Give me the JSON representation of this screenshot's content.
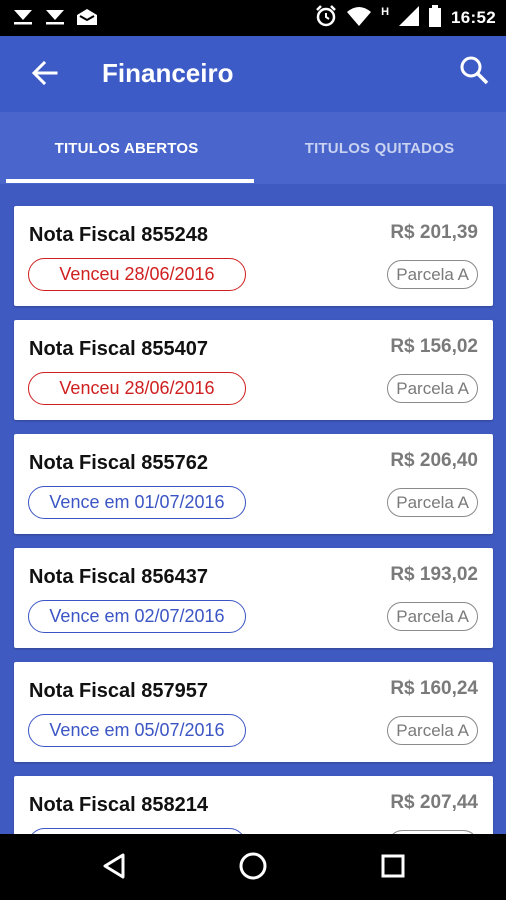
{
  "status_bar": {
    "time": "16:52",
    "icons": [
      "download-icon",
      "download-icon",
      "mail-icon",
      "alarm-icon",
      "wifi-icon",
      "network-h-icon",
      "signal-icon",
      "battery-icon"
    ],
    "network_label": "H"
  },
  "app_bar": {
    "title": "Financeiro",
    "back_icon": "arrow-left-icon",
    "search_icon": "search-icon",
    "color": "#3d5bc6"
  },
  "tabs": [
    {
      "label": "TITULOS ABERTOS",
      "selected": true
    },
    {
      "label": "TITULOS QUITADOS",
      "selected": false
    }
  ],
  "colors": {
    "overdue": "#cf1f1f",
    "upcoming": "#3b55c4",
    "background": "#3f5bc2"
  },
  "items": [
    {
      "title": "Nota Fiscal 855248",
      "amount": "R$ 201,39",
      "due": "Venceu 28/06/2016",
      "status": "overdue",
      "parcel": "Parcela A"
    },
    {
      "title": "Nota Fiscal 855407",
      "amount": "R$ 156,02",
      "due": "Venceu 28/06/2016",
      "status": "overdue",
      "parcel": "Parcela A"
    },
    {
      "title": "Nota Fiscal 855762",
      "amount": "R$ 206,40",
      "due": "Vence em 01/07/2016",
      "status": "upcoming",
      "parcel": "Parcela A"
    },
    {
      "title": "Nota Fiscal 856437",
      "amount": "R$ 193,02",
      "due": "Vence em 02/07/2016",
      "status": "upcoming",
      "parcel": "Parcela A"
    },
    {
      "title": "Nota Fiscal 857957",
      "amount": "R$ 160,24",
      "due": "Vence em 05/07/2016",
      "status": "upcoming",
      "parcel": "Parcela A"
    },
    {
      "title": "Nota Fiscal 858214",
      "amount": "R$ 207,44",
      "due": "",
      "status": "upcoming",
      "parcel": ""
    }
  ],
  "nav_bar": {
    "icons": [
      "back-triangle-icon",
      "home-circle-icon",
      "recents-square-icon"
    ]
  }
}
